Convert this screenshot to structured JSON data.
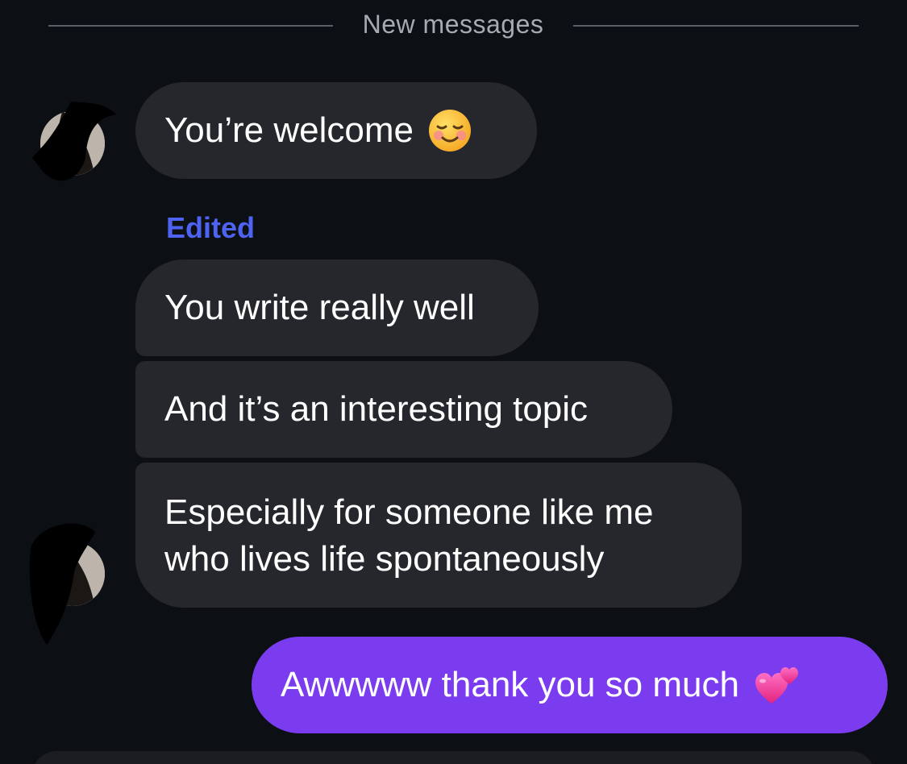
{
  "divider": {
    "label": "New messages"
  },
  "messages": [
    {
      "direction": "received",
      "text": "You’re welcome",
      "emoji": "smiling-face-icon"
    },
    {
      "direction": "received",
      "status": "Edited",
      "text": "You write really well"
    },
    {
      "direction": "received",
      "text": "And it’s an interesting topic"
    },
    {
      "direction": "received",
      "text": "Especially for someone like me who lives life spontaneously"
    },
    {
      "direction": "sent",
      "text": "Awwwww thank you so much",
      "emoji": "two-hearts-icon"
    }
  ],
  "colors": {
    "background": "#0c0f13",
    "received_bubble": "#25272c",
    "sent_bubble": "#7b3cf0",
    "edited_label": "#4f63f2",
    "divider_text": "#a6aab2"
  }
}
